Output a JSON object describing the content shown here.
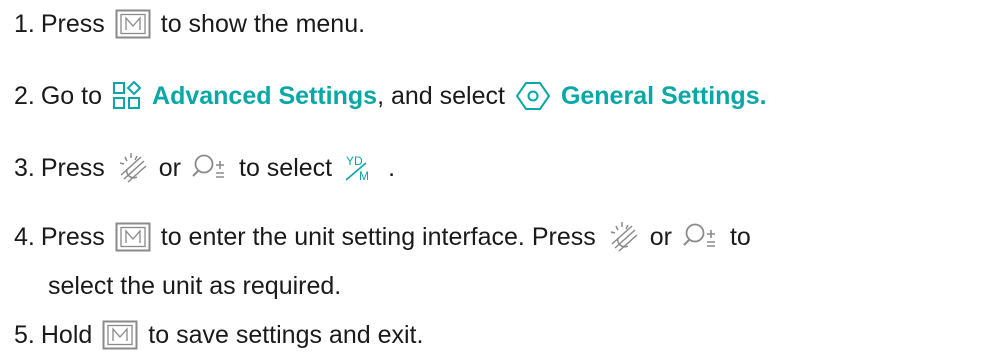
{
  "steps": [
    {
      "number": "1.",
      "parts": {
        "a": "Press",
        "b": "to show the menu."
      }
    },
    {
      "number": "2.",
      "parts": {
        "a": "Go to",
        "menu1": "Advanced Settings",
        "b": ", and select",
        "menu2": "General Settings."
      }
    },
    {
      "number": "3.",
      "parts": {
        "a": "Press",
        "b": "or",
        "c": "to select",
        "d": "."
      }
    },
    {
      "number": "4.",
      "parts": {
        "a": "Press",
        "b": "to enter the unit setting interface. Press",
        "c": "or",
        "d": "to",
        "e": "select the unit as required."
      }
    },
    {
      "number": "5.",
      "parts": {
        "a": "Hold",
        "b": "to save settings and exit."
      }
    }
  ],
  "icons": {
    "menu_button": "m-button-icon",
    "advanced_settings": "advanced-settings-icon",
    "general_settings": "general-settings-icon",
    "brightness": "brightness-icon",
    "zoom": "zoom-icon",
    "unit": "unit-icon",
    "unit_glyph_top": "YD",
    "unit_glyph_bottom": "M"
  },
  "colors": {
    "accent": "#0aa7a7",
    "text": "#1a1a1a",
    "icon_gray": "#8a8a8a"
  }
}
